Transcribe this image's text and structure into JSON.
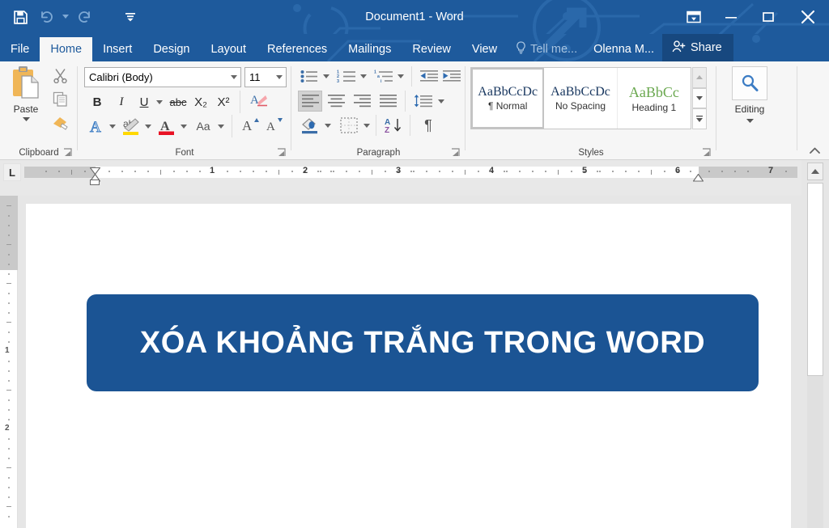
{
  "window": {
    "title": "Document1 - Word",
    "min_label": "–",
    "restore_label": "❐",
    "close_label": "✕",
    "ribbon_display_label": "ribbon-display-options"
  },
  "quick_access": [
    {
      "name": "save-icon",
      "label": "Save",
      "enabled": true
    },
    {
      "name": "undo-icon",
      "label": "Undo",
      "enabled": false
    },
    {
      "name": "redo-icon",
      "label": "Redo",
      "enabled": false
    },
    {
      "name": "customize-qat-icon",
      "label": "Customize Quick Access Toolbar",
      "enabled": true
    }
  ],
  "tabs": [
    {
      "label": "File",
      "active": false
    },
    {
      "label": "Home",
      "active": true
    },
    {
      "label": "Insert",
      "active": false
    },
    {
      "label": "Design",
      "active": false
    },
    {
      "label": "Layout",
      "active": false
    },
    {
      "label": "References",
      "active": false
    },
    {
      "label": "Mailings",
      "active": false
    },
    {
      "label": "Review",
      "active": false
    },
    {
      "label": "View",
      "active": false
    }
  ],
  "tell_me": {
    "label": "Tell me...",
    "icon": "lightbulb-icon"
  },
  "account": {
    "name": "Olenna M..."
  },
  "share": {
    "label": "Share",
    "icon": "share-person-icon"
  },
  "ribbon": {
    "groups": [
      {
        "label": "Clipboard"
      },
      {
        "label": "Font"
      },
      {
        "label": "Paragraph"
      },
      {
        "label": "Styles"
      }
    ],
    "clipboard": {
      "paste_label": "Paste",
      "items": [
        "paste-icon",
        "cut-icon",
        "copy-icon",
        "format-painter-icon"
      ]
    },
    "font": {
      "font_name": "Calibri (Body)",
      "font_size": "11",
      "bold": "B",
      "italic": "I",
      "underline": "U",
      "strikethrough": "abc",
      "subscript": "X₂",
      "superscript": "X²",
      "clear_formatting": "clear-formatting-icon",
      "text_effects": "text-effects-icon",
      "highlight": "text-highlight-icon",
      "font_color": "font-color-icon",
      "change_case": "Aa",
      "grow_font": "A",
      "shrink_font": "A"
    },
    "paragraph": {
      "items": [
        "bullets-icon",
        "numbering-icon",
        "multilevel-list-icon",
        "decrease-indent-icon",
        "increase-indent-icon",
        "align-left-icon",
        "align-center-icon",
        "align-right-icon",
        "justify-icon",
        "line-spacing-icon",
        "shading-icon",
        "borders-icon",
        "sort-icon",
        "show-formatting-marks-icon"
      ]
    },
    "styles": [
      {
        "preview": "AaBbCcDc",
        "name": "¶ Normal",
        "active": true,
        "kind": "normal"
      },
      {
        "preview": "AaBbCcDc",
        "name": "No Spacing",
        "active": false,
        "kind": "normal"
      },
      {
        "preview": "AaBbCc",
        "name": "Heading 1",
        "active": false,
        "kind": "h1"
      }
    ],
    "editing": {
      "label": "Editing",
      "icon": "magnifier-icon"
    },
    "collapse_icon": "collapse-ribbon-icon"
  },
  "ruler": {
    "tab_selector": "L",
    "numbers": [
      "1",
      "2",
      "3",
      "4",
      "5",
      "6",
      "7"
    ],
    "vertical_numbers": [
      "1",
      "2"
    ]
  },
  "document": {
    "banner_text": "XÓA KHOẢNG TRẮNG TRONG WORD",
    "banner_color": "#1b5494"
  },
  "colors": {
    "title_bar": "#1e5a9c",
    "ribbon_bg": "#f6f6f6",
    "accent": "#1b5494",
    "tab_active_text": "#1e5a9c",
    "share_bg": "#17487f",
    "heading1_green": "#6aa84f",
    "highlight_yellow": "#ffd800",
    "font_color_red": "#e81123"
  },
  "scrollbar": {
    "up_label": "scroll-up-icon"
  }
}
